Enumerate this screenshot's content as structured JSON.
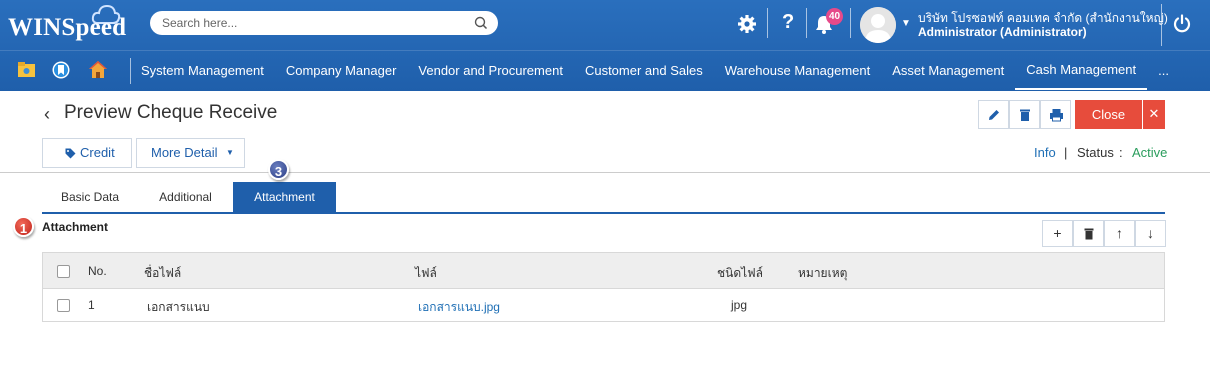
{
  "app": {
    "logo_text": "WINSpeed"
  },
  "search": {
    "placeholder": "Search here..."
  },
  "header": {
    "notification_count": "40",
    "company": "บริษัท โปรซอฟท์ คอมเทค จำกัด (สำนักงานใหญ่)",
    "user": "Administrator (Administrator)"
  },
  "menu": {
    "items": [
      "System Management",
      "Company Manager",
      "Vendor and Procurement",
      "Customer and Sales",
      "Warehouse Management",
      "Asset Management",
      "Cash Management",
      "..."
    ],
    "active": "Cash Management"
  },
  "page": {
    "title": "Preview Cheque Receive",
    "close_label": "Close",
    "credit_label": "Credit",
    "more_detail_label": "More Detail",
    "info_label": "Info",
    "info_separator": "|",
    "status_label": "Status",
    "status_colon": ":",
    "status_value": "Active"
  },
  "tabs": [
    "Basic Data",
    "Additional",
    "Attachment"
  ],
  "active_tab": "Attachment",
  "steps": {
    "tab_step": "3",
    "section_step": "1"
  },
  "attachment": {
    "title": "Attachment",
    "columns": [
      "No.",
      "ชื่อไฟล์",
      "ไฟล์",
      "ชนิดไฟล์",
      "หมายเหตุ"
    ],
    "rows": [
      {
        "no": "1",
        "name": "เอกสารแนบ",
        "file": "เอกสารแนบ.jpg",
        "type": "jpg",
        "note": ""
      }
    ]
  },
  "colors": {
    "header_bg": "#1f5fab",
    "close_bg": "#e74c3c",
    "status_active": "#2a9d5c",
    "link": "#1f6fb5"
  }
}
